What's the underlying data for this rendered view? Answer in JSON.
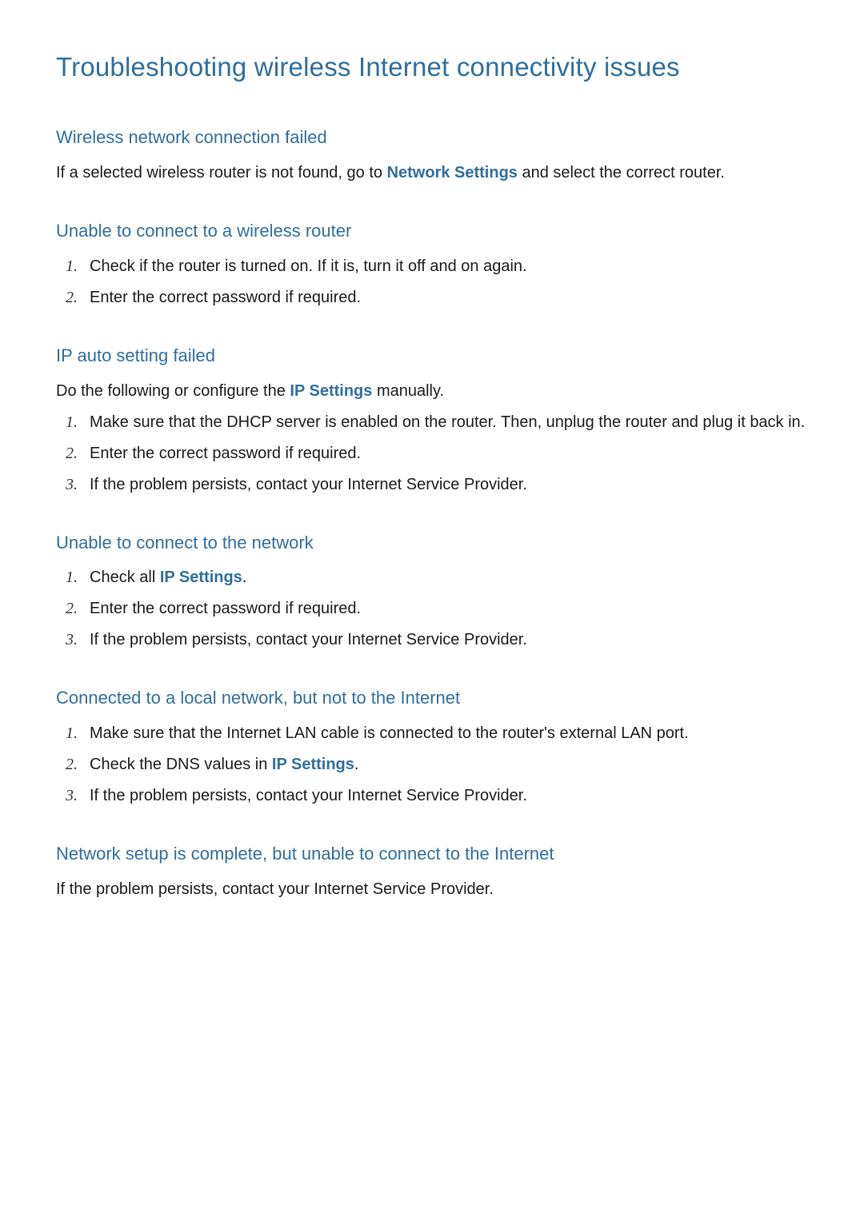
{
  "page": {
    "title": "Troubleshooting wireless Internet connectivity issues"
  },
  "link": {
    "network_settings": "Network Settings",
    "ip_settings": "IP Settings"
  },
  "sections": {
    "s1": {
      "title": "Wireless network connection failed",
      "text_before": "If a selected wireless router is not found, go to ",
      "text_after": " and select the correct router."
    },
    "s2": {
      "title": "Unable to connect to a wireless router",
      "items": {
        "i1": "Check if the router is turned on. If it is, turn it off and on again.",
        "i2": "Enter the correct password if required."
      }
    },
    "s3": {
      "title": "IP auto setting failed",
      "text_before": "Do the following or configure the ",
      "text_after": " manually.",
      "items": {
        "i1": "Make sure that the DHCP server is enabled on the router. Then, unplug the router and plug it back in.",
        "i2": "Enter the correct password if required.",
        "i3": "If the problem persists, contact your Internet Service Provider."
      }
    },
    "s4": {
      "title": "Unable to connect to the network",
      "items": {
        "i1_before": "Check all ",
        "i1_after": ".",
        "i2": "Enter the correct password if required.",
        "i3": "If the problem persists, contact your Internet Service Provider."
      }
    },
    "s5": {
      "title": "Connected to a local network, but not to the Internet",
      "items": {
        "i1": "Make sure that the Internet LAN cable is connected to the router's external LAN port.",
        "i2_before": "Check the DNS values in ",
        "i2_after": ".",
        "i3": "If the problem persists, contact your Internet Service Provider."
      }
    },
    "s6": {
      "title": "Network setup is complete, but unable to connect to the Internet",
      "text": "If the problem persists, contact your Internet Service Provider."
    }
  },
  "numerals": {
    "n1": "1.",
    "n2": "2.",
    "n3": "3."
  }
}
